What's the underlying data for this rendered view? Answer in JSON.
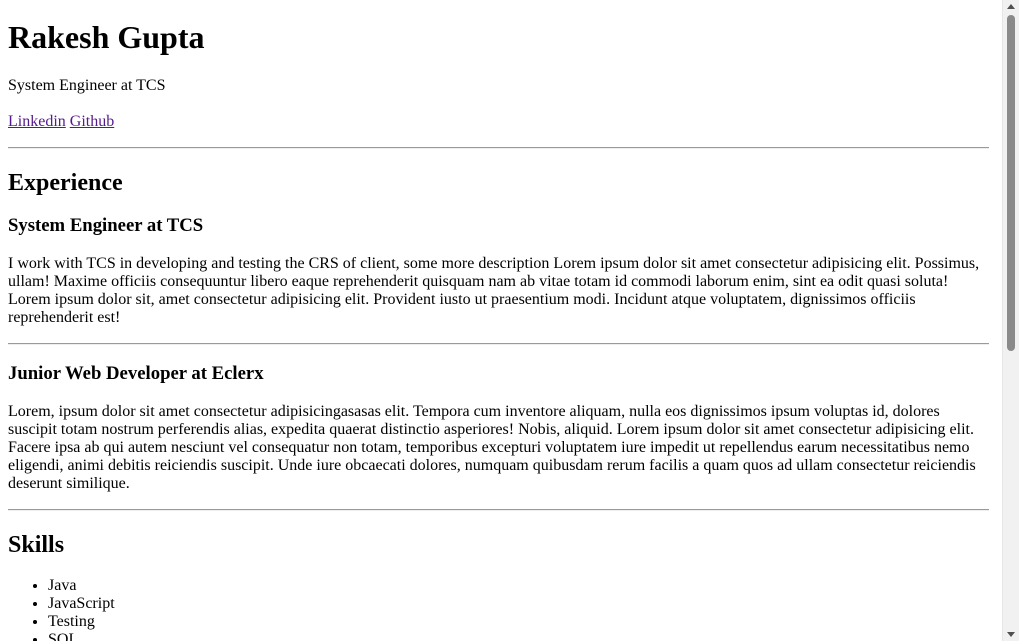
{
  "header": {
    "name": "Rakesh Gupta",
    "tagline": "System Engineer at TCS",
    "links": [
      {
        "label": "Linkedin"
      },
      {
        "label": "Github"
      }
    ]
  },
  "experience": {
    "heading": "Experience",
    "items": [
      {
        "title": "System Engineer at TCS",
        "description": "I work with TCS in developing and testing the CRS of client, some more description Lorem ipsum dolor sit amet consectetur adipisicing elit. Possimus, ullam! Maxime officiis consequuntur libero eaque reprehenderit quisquam nam ab vitae totam id commodi laborum enim, sint ea odit quasi soluta! Lorem ipsum dolor sit, amet consectetur adipisicing elit. Provident iusto ut praesentium modi. Incidunt atque voluptatem, dignissimos officiis reprehenderit est!"
      },
      {
        "title": "Junior Web Developer at Eclerx",
        "description": "Lorem, ipsum dolor sit amet consectetur adipisicingasasas elit. Tempora cum inventore aliquam, nulla eos dignissimos ipsum voluptas id, dolores suscipit totam nostrum perferendis alias, expedita quaerat distinctio asperiores! Nobis, aliquid. Lorem ipsum dolor sit amet consectetur adipisicing elit. Facere ipsa ab qui autem nesciunt vel consequatur non totam, temporibus excepturi voluptatem iure impedit ut repellendus earum necessitatibus nemo eligendi, animi debitis reiciendis suscipit. Unde iure obcaecati dolores, numquam quibusdam rerum facilis a quam quos ad ullam consectetur reiciendis deserunt similique."
      }
    ]
  },
  "skills": {
    "heading": "Skills",
    "items": [
      "Java",
      "JavaScript",
      "Testing",
      "SQL"
    ]
  }
}
